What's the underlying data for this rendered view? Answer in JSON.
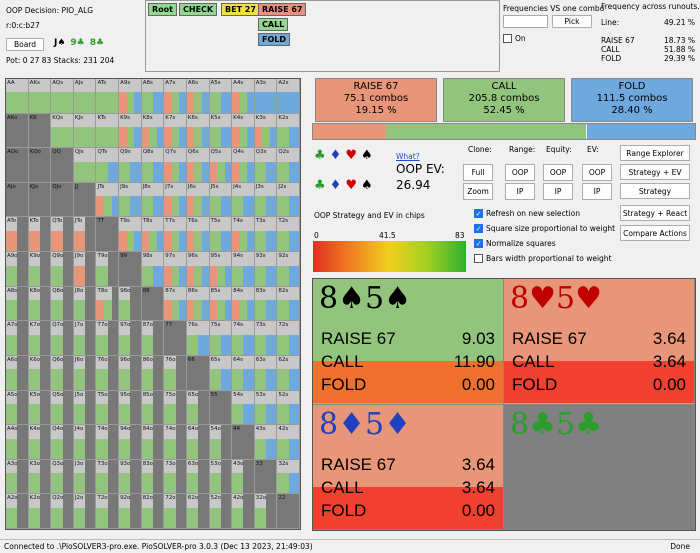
{
  "header": {
    "decision": "OOP Decision:  PIO_ALG",
    "node_path": "r:0:c:b27",
    "board_button": "Board",
    "board_cards": [
      {
        "text": "J♠",
        "color": "#000000"
      },
      {
        "text": "9♣",
        "color": "#2a9d2a"
      },
      {
        "text": "8♣",
        "color": "#2a9d2a"
      }
    ],
    "pot_line": "Pot: 0 27 83 Stacks: 231 204"
  },
  "tree": {
    "nodes": [
      {
        "label": "Root",
        "bg": "#90d890"
      },
      {
        "label": "CHECK",
        "bg": "#90d890"
      },
      {
        "label": "BET 27",
        "bg": "#f0e040"
      },
      {
        "label": "RAISE 67",
        "bg": "#e89080"
      },
      {
        "label": "CALL",
        "bg": "#90d890"
      },
      {
        "label": "FOLD",
        "bg": "#70a8d8"
      }
    ]
  },
  "one_combo": {
    "title": "Frequencies VS one combo",
    "input_value": "",
    "pick_button": "Pick",
    "on_label": "On"
  },
  "runouts": {
    "title": "Frequency across runouts.",
    "line_label": "Line:",
    "line_value": "49.21 %",
    "rows": [
      {
        "label": "RAISE 67",
        "value": "18.73 %"
      },
      {
        "label": "CALL",
        "value": "51.88 %"
      },
      {
        "label": "FOLD",
        "value": "29.39 %"
      }
    ]
  },
  "actions": [
    {
      "name": "RAISE 67",
      "combos": "75.1 combos",
      "pct": "19.15 %",
      "color": "#e8967a"
    },
    {
      "name": "CALL",
      "combos": "205.8 combos",
      "pct": "52.45 %",
      "color": "#93c47d"
    },
    {
      "name": "FOLD",
      "combos": "111.5 combos",
      "pct": "28.40 %",
      "color": "#6fa8dc"
    }
  ],
  "strategy_bar": [
    {
      "frac": 0.1915,
      "color": "#e8967a"
    },
    {
      "frac": 0.5245,
      "color": "#93c47d"
    },
    {
      "frac": 0.284,
      "color": "#6fa8dc"
    }
  ],
  "controls": {
    "what_link": "What?",
    "oop_ev_label": "OOP EV:",
    "oop_ev_value": "26.94",
    "clone_label": "Clone:",
    "range_label": "Range:",
    "equity_label": "Equity:",
    "ev_label": "EV:",
    "full": "Full",
    "zoom": "Zoom",
    "oop1": "OOP",
    "oop2": "OOP",
    "oop3": "OOP",
    "ip1": "IP",
    "ip2": "IP",
    "ip3": "IP",
    "range_explorer": "Range Explorer",
    "strategy_ev": "Strategy + EV",
    "strategy": "Strategy",
    "strategy_react": "Strategy + React",
    "compare_actions": "Compare Actions",
    "chart_label": "OOP Strategy and EV in chips",
    "scale_min": "0",
    "scale_mid": "41.5",
    "scale_max": "83",
    "checks": [
      {
        "label": "Refresh on new selection",
        "on": true
      },
      {
        "label": "Square size proportional to weight",
        "on": true
      },
      {
        "label": "Normalize squares",
        "on": true
      },
      {
        "label": "Bars width proportional to weight",
        "on": false
      }
    ]
  },
  "combos": [
    {
      "title": "8♠5♠",
      "title_color": "#000000",
      "rows": [
        [
          "RAISE 67",
          "9.03"
        ],
        [
          "CALL",
          "11.90"
        ],
        [
          "FOLD",
          "0.00"
        ]
      ],
      "bg": "#93c47d",
      "raise_frac": 0.0,
      "fold_color": "#f07030"
    },
    {
      "title": "8♥5♥",
      "title_color": "#c00000",
      "rows": [
        [
          "RAISE 67",
          "3.64"
        ],
        [
          "CALL",
          "3.64"
        ],
        [
          "FOLD",
          "0.00"
        ]
      ],
      "bg": "#e8967a",
      "raise_frac": 1.0,
      "fold_color": "#f04030"
    },
    {
      "title": "8♦5♦",
      "title_color": "#2040c0",
      "rows": [
        [
          "RAISE 67",
          "3.64"
        ],
        [
          "CALL",
          "3.64"
        ],
        [
          "FOLD",
          "0.00"
        ]
      ],
      "bg": "#e8967a",
      "raise_frac": 1.0,
      "fold_color": "#f04030"
    },
    {
      "title": "8♣5♣",
      "title_color": "#2a9d2a",
      "rows": [],
      "bg": "#808080",
      "raise_frac": 0.0,
      "fold_color": "#808080"
    }
  ],
  "status": {
    "connected": "Connected to .\\PioSOLVER3-pro.exe. PioSOLVER-pro 3.0.3 (Dec 13 2023, 21:49:03)",
    "done": "Done"
  },
  "matrix": {
    "ranks": [
      "A",
      "K",
      "Q",
      "J",
      "T",
      "9",
      "8",
      "7",
      "6",
      "5",
      "4",
      "3",
      "2"
    ],
    "cells": [
      "g",
      "g",
      "g",
      "g",
      "g",
      "rgb",
      "gb",
      "rgb",
      "rgb",
      "gb",
      "rgb",
      "b",
      "b",
      "n",
      "n",
      "g",
      "g",
      "g",
      "rgb",
      "rgb",
      "rgb",
      "rgb",
      "gb",
      "rgb",
      "rgb",
      "gb",
      "n",
      "n",
      "n",
      "g",
      "gb",
      "gb",
      "gb",
      "rgb",
      "rgb",
      "rgb",
      "rgb",
      "gb",
      "gb",
      "n",
      "n",
      "n",
      "n",
      "rgb",
      "gb",
      "gb",
      "rgb",
      "rgb",
      "gb",
      "gb",
      "gb",
      "gb",
      "rn",
      "rn",
      "rn",
      "rn",
      "n",
      "rgb",
      "rgb",
      "rgb",
      "rgb",
      "gb",
      "rgb",
      "gb",
      "gb",
      "gn",
      "gn",
      "gn",
      "rn",
      "gn",
      "n",
      "gb",
      "rgb",
      "rgb",
      "rgb",
      "gb",
      "gb",
      "gb",
      "gn",
      "gn",
      "gn",
      "gn",
      "rgn",
      "gn",
      "n",
      "rgb",
      "rgb",
      "rgb",
      "rgb",
      "gb",
      "gb",
      "gn",
      "gn",
      "gn",
      "gn",
      "gn",
      "gn",
      "gn",
      "n",
      "gb",
      "gb",
      "gb",
      "gb",
      "gb",
      "gn",
      "gn",
      "gn",
      "gn",
      "gn",
      "gn",
      "gn",
      "gn",
      "n",
      "gb",
      "gb",
      "gb",
      "gb",
      "gn",
      "gn",
      "gn",
      "gn",
      "gn",
      "gn",
      "gn",
      "gn",
      "gn",
      "n",
      "gb",
      "gb",
      "gb",
      "gn",
      "gn",
      "gn",
      "gn",
      "gn",
      "gn",
      "gn",
      "gn",
      "gn",
      "gn",
      "n",
      "gb",
      "gb",
      "gn",
      "gn",
      "gn",
      "gn",
      "gn",
      "gn",
      "gn",
      "gn",
      "gn",
      "gn",
      "gn",
      "n",
      "gb",
      "gn",
      "gn",
      "gn",
      "gn",
      "gn",
      "gn",
      "gn",
      "gn",
      "gn",
      "gn",
      "gn",
      "gn",
      "n"
    ]
  }
}
